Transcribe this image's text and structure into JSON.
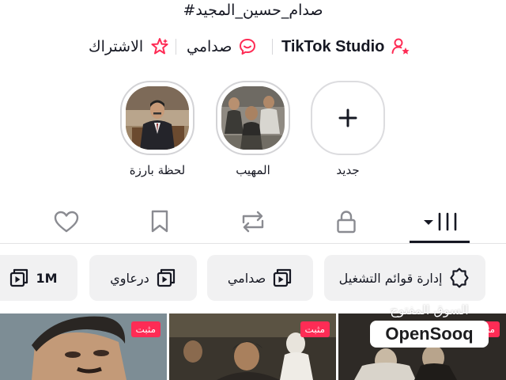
{
  "profile": {
    "hashtag": "#صدام_حسين_المجيد"
  },
  "links": {
    "studio": "TikTok Studio",
    "sadami": "صدامي",
    "subscribe": "الاشتراك"
  },
  "highlights": [
    {
      "label": "لحظة بارزة"
    },
    {
      "label": "المهيب"
    },
    {
      "label": "جديد"
    }
  ],
  "tabs": {
    "active": "grid"
  },
  "playlists": {
    "manage": "إدارة قوائم التشغيل",
    "items": [
      "صدامي",
      "درعاوي",
      "1M"
    ]
  },
  "videos": {
    "pinned_label": "مثبت"
  },
  "watermark": {
    "arabic": "السوق المفتوح",
    "brand": "OpenSooq"
  },
  "colors": {
    "accent": "#fe2c55",
    "text": "#161823",
    "chip_bg": "#f1f1f2"
  },
  "icons": {
    "studio": "person-star-icon",
    "sadami": "chat-bubble-icon",
    "subscribe": "star-sparkle-icon",
    "new_highlight": "plus-icon",
    "tab_grid": "grid-dropdown-icon",
    "tab_private": "lock-icon",
    "tab_repost": "repost-icon",
    "tab_saved": "bookmark-icon",
    "tab_liked": "heart-icon",
    "manage": "gear-icon",
    "playlist": "playlist-icon"
  }
}
